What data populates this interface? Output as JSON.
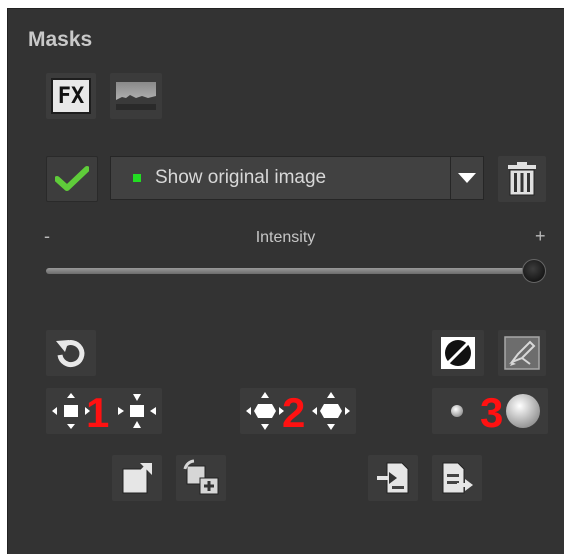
{
  "panel": {
    "title": "Masks"
  },
  "toolbar": {
    "fx_label": "FX",
    "fx_icon": "fx-icon",
    "image_icon": "landscape-thumbnail-icon"
  },
  "mask_select": {
    "confirm_icon": "checkmark-icon",
    "selected_value": "Show original image",
    "indicator_color": "#22dd22",
    "dropdown_icon": "chevron-down-icon",
    "delete_icon": "trash-icon"
  },
  "intensity": {
    "label": "Intensity",
    "min_label": "-",
    "max_label": "+",
    "value_fraction": 1.0
  },
  "tools": {
    "reset_icon": "undo-icon",
    "invert_icon": "invert-mask-icon",
    "brush_icon": "brush-icon",
    "group1_label": "1",
    "group2_label": "2",
    "group3_label": "3",
    "marker_color": "#ff1111"
  },
  "bottom_actions": {
    "export_icon": "export-mask-icon",
    "add_icon": "add-mask-icon",
    "import_icon": "import-file-icon",
    "save_icon": "save-file-icon"
  }
}
